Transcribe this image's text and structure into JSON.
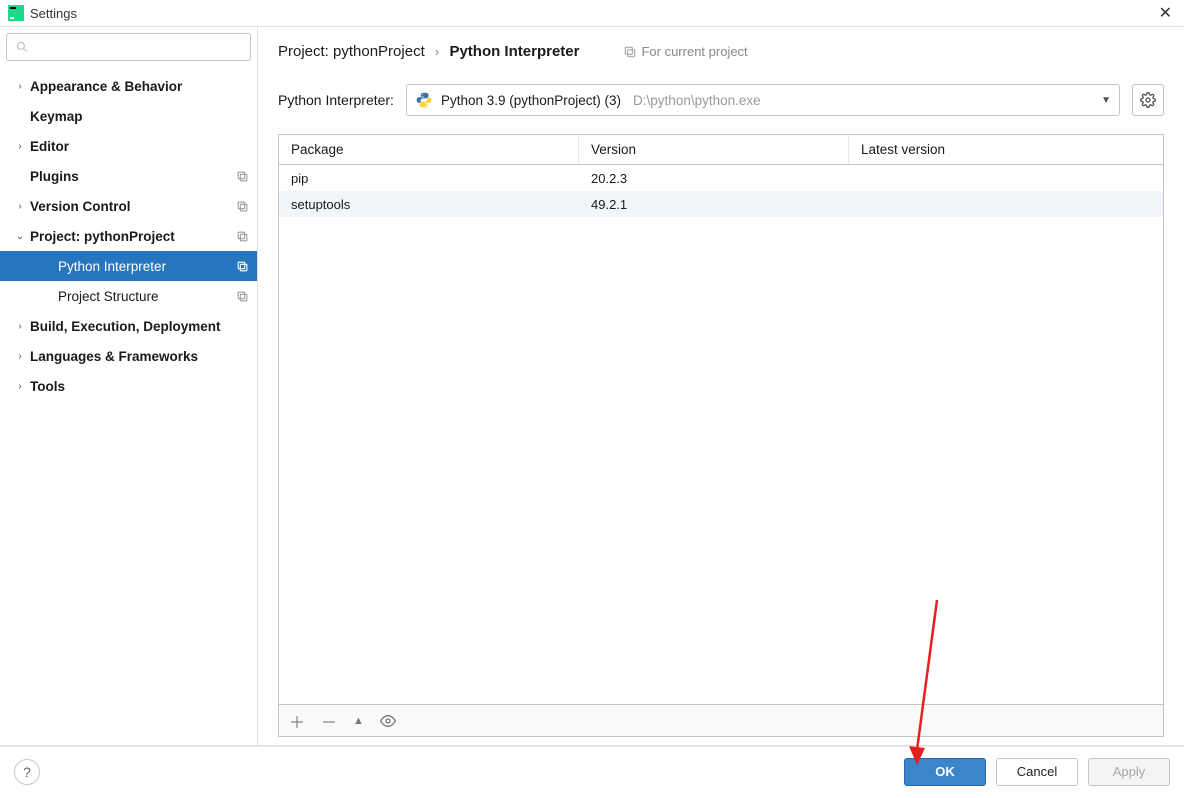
{
  "window": {
    "title": "Settings"
  },
  "sidebar": {
    "search_placeholder": "",
    "items": [
      {
        "label": "Appearance & Behavior",
        "chev": "›",
        "bold": true
      },
      {
        "label": "Keymap",
        "chev": "",
        "bold": true
      },
      {
        "label": "Editor",
        "chev": "›",
        "bold": true
      },
      {
        "label": "Plugins",
        "chev": "",
        "bold": true,
        "badge": true
      },
      {
        "label": "Version Control",
        "chev": "›",
        "bold": true,
        "badge": true
      },
      {
        "label": "Project: pythonProject",
        "chev": "⌄",
        "bold": true,
        "badge": true,
        "expanded": true
      },
      {
        "label": "Python Interpreter",
        "child": true,
        "selected": true,
        "badge": true
      },
      {
        "label": "Project Structure",
        "child": true,
        "badge": true
      },
      {
        "label": "Build, Execution, Deployment",
        "chev": "›",
        "bold": true
      },
      {
        "label": "Languages & Frameworks",
        "chev": "›",
        "bold": true
      },
      {
        "label": "Tools",
        "chev": "›",
        "bold": true
      }
    ]
  },
  "breadcrumb": {
    "part1": "Project: pythonProject",
    "sep": "›",
    "part2": "Python Interpreter"
  },
  "hint": "For current project",
  "interpreter": {
    "label": "Python Interpreter:",
    "name": "Python 3.9 (pythonProject) (3)",
    "path": "D:\\python\\python.exe"
  },
  "table": {
    "headers": {
      "package": "Package",
      "version": "Version",
      "latest": "Latest version"
    },
    "rows": [
      {
        "package": "pip",
        "version": "20.2.3",
        "latest": ""
      },
      {
        "package": "setuptools",
        "version": "49.2.1",
        "latest": ""
      }
    ]
  },
  "footer": {
    "ok": "OK",
    "cancel": "Cancel",
    "apply": "Apply"
  }
}
